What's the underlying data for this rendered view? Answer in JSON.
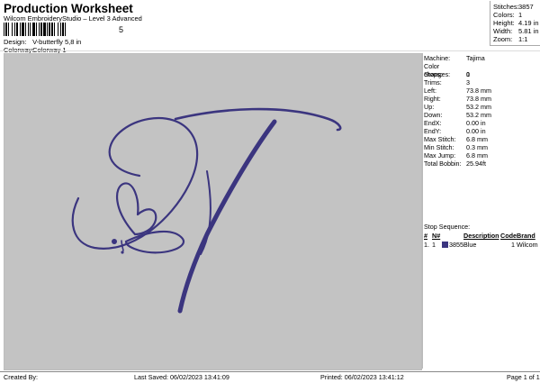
{
  "header": {
    "title": "Production Worksheet",
    "subtitle": "Wilcom EmbroideryStudio – Level 3 Advanced",
    "barcode_suffix": "5"
  },
  "design_info": {
    "design_label": "Design:",
    "design_value": "V-butterfly 5,8 in",
    "colorway_label": "Colorway:",
    "colorway_value": "Colorway 1"
  },
  "stats": [
    {
      "label": "Stitches:",
      "value": "3857"
    },
    {
      "label": "Colors:",
      "value": "1"
    },
    {
      "label": "Height:",
      "value": "4.19 in"
    },
    {
      "label": "Width:",
      "value": "5.81 in"
    },
    {
      "label": "Zoom:",
      "value": "1:1"
    }
  ],
  "design_color": "#3b357f",
  "machine_info": [
    {
      "label": "Machine:",
      "value": "Tajima"
    },
    {
      "label": "Color changes:",
      "value": "0"
    },
    {
      "label": "Stops:",
      "value": "1"
    },
    {
      "label": "Trims:",
      "value": "3"
    },
    {
      "label": "Left:",
      "value": "73.8 mm"
    },
    {
      "label": "Right:",
      "value": "73.8 mm"
    },
    {
      "label": "Up:",
      "value": "53.2 mm"
    },
    {
      "label": "Down:",
      "value": "53.2 mm"
    },
    {
      "label": "EndX:",
      "value": "0.00 in"
    },
    {
      "label": "EndY:",
      "value": "0.00 in"
    },
    {
      "label": "Max Stitch:",
      "value": "6.8 mm"
    },
    {
      "label": "Min Stitch:",
      "value": "0.3 mm"
    },
    {
      "label": "Max Jump:",
      "value": "6.8 mm"
    },
    {
      "label": "Total Bobbin:",
      "value": "25.94ft"
    }
  ],
  "stop_sequence": {
    "title": "Stop Sequence:",
    "headers": [
      "#",
      "N#",
      "Description",
      "Code",
      "Brand"
    ],
    "rows": [
      {
        "num": "1.",
        "n": "1",
        "stitches": "3855",
        "description": "Blue",
        "code": "1",
        "brand": "Wilcom"
      }
    ]
  },
  "footer": {
    "created_by": "Created By:",
    "last_saved": "Last Saved: 06/02/2023 13:41:09",
    "printed": "Printed: 06/02/2023 13:41:12",
    "page": "Page 1 of 1"
  }
}
